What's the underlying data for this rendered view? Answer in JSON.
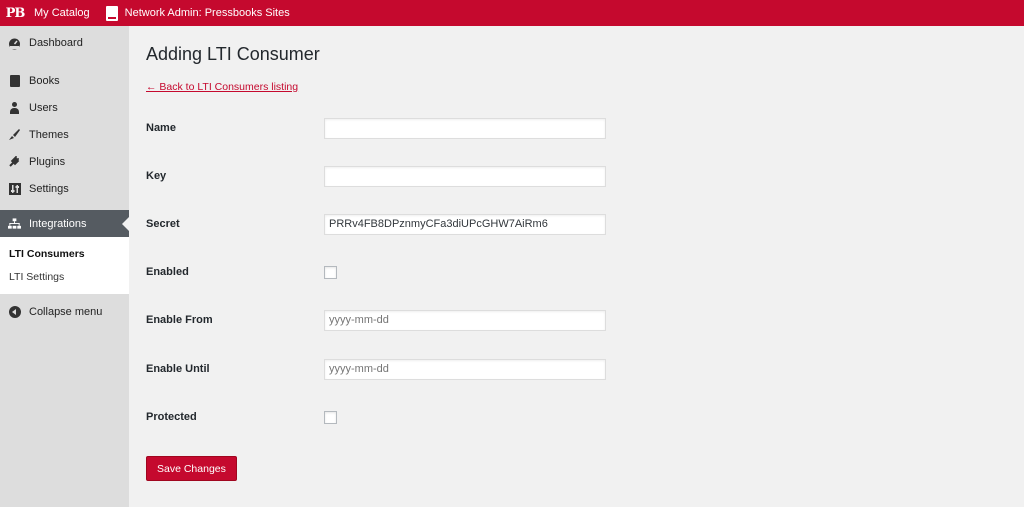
{
  "adminbar": {
    "logo": "PB",
    "my_catalog": "My Catalog",
    "network_admin": "Network Admin: Pressbooks Sites"
  },
  "sidebar": {
    "items": [
      {
        "label": "Dashboard",
        "icon": "dashboard-icon"
      },
      {
        "label": "Books",
        "icon": "book-icon"
      },
      {
        "label": "Users",
        "icon": "user-icon"
      },
      {
        "label": "Themes",
        "icon": "brush-icon"
      },
      {
        "label": "Plugins",
        "icon": "plug-icon"
      },
      {
        "label": "Settings",
        "icon": "settings-icon"
      },
      {
        "label": "Integrations",
        "icon": "sitemap-icon"
      }
    ],
    "submenu": [
      {
        "label": "LTI Consumers"
      },
      {
        "label": "LTI Settings"
      }
    ],
    "collapse_label": "Collapse menu"
  },
  "main": {
    "title": "Adding LTI Consumer",
    "back_link": "← Back to LTI Consumers listing",
    "fields": {
      "name": {
        "label": "Name",
        "value": ""
      },
      "key": {
        "label": "Key",
        "value": ""
      },
      "secret": {
        "label": "Secret",
        "value": "PRRv4FB8DPznmyCFa3diUPcGHW7AiRm6"
      },
      "enabled": {
        "label": "Enabled",
        "checked": false
      },
      "enable_from": {
        "label": "Enable From",
        "placeholder": "yyyy-mm-dd"
      },
      "enable_until": {
        "label": "Enable Until",
        "placeholder": "yyyy-mm-dd"
      },
      "protected": {
        "label": "Protected",
        "checked": false
      }
    },
    "save_label": "Save Changes"
  },
  "colors": {
    "brand": "#c5092e",
    "sidebar_bg": "#dddddd",
    "content_bg": "#f1f1f1"
  }
}
